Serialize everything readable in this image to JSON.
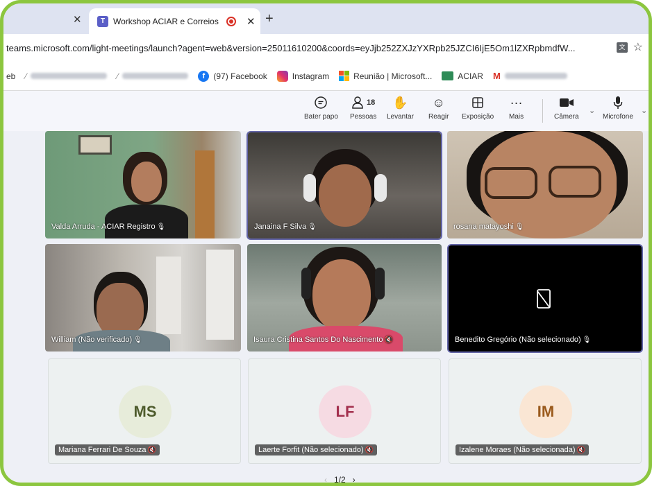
{
  "browser": {
    "active_tab_title": "Workshop ACIAR e Correios",
    "url": "teams.microsoft.com/light-meetings/launch?agent=web&version=25011610200&coords=eyJjb252ZXJzYXRpb25JZCI6IjE5Om1lZXRpbmdfW...",
    "bookmarks": {
      "first_partial": "eb",
      "facebook": "(97) Facebook",
      "instagram": "Instagram",
      "teams_meeting": "Reunião | Microsoft...",
      "aciar": "ACIAR",
      "gmail_letter": "M"
    }
  },
  "toolbar": {
    "chat": "Bater papo",
    "people": "Pessoas",
    "people_count": "18",
    "raise_hand": "Levantar",
    "react": "Reagir",
    "view": "Exposição",
    "more": "Mais",
    "camera": "Câmera",
    "microphone": "Microfone"
  },
  "participants": {
    "p1": "Valda Arruda - ACIAR Registro",
    "p2": "Janaina F Silva",
    "p3": "rosana matayoshi",
    "p4": "William (Não verificado)",
    "p5": "Isaura Cristina Santos Do Nascimento",
    "p6": "Benedito Gregório (Não selecionado)",
    "p7": "Mariana Ferrari De Souza",
    "p8": "Laerte Forfit (Não selecionado)",
    "p9": "Izalene Moraes (Não selecionada)"
  },
  "avatars": {
    "a7": "MS",
    "a8": "LF",
    "a9": "IM"
  },
  "colors": {
    "frame": "#8cc63f",
    "teams_accent": "#6264a7",
    "avatar_ms_bg": "#e7ecda",
    "avatar_lf_bg": "#f6dbe3",
    "avatar_im_bg": "#fae6d4"
  },
  "pagination": {
    "label": "1/2"
  }
}
